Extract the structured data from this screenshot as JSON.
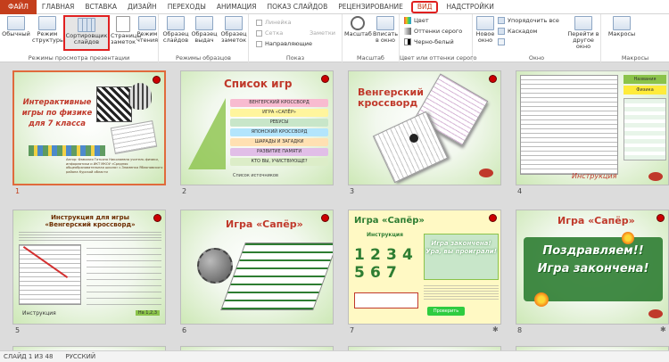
{
  "tabs": [
    "ФАЙЛ",
    "ГЛАВНАЯ",
    "ВСТАВКА",
    "ДИЗАЙН",
    "ПЕРЕХОДЫ",
    "АНИМАЦИЯ",
    "ПОКАЗ СЛАЙДОВ",
    "РЕЦЕНЗИРОВАНИЕ",
    "ВИД",
    "НАДСТРОЙКИ"
  ],
  "ribbon": {
    "views": {
      "label": "Режимы просмотра презентации",
      "normal": "Обычный",
      "outline": "Режим структуры",
      "sorter": "Сортировщик слайдов",
      "notes": "Страницы заметок",
      "reading": "Режим чтения"
    },
    "masters": {
      "label": "Режимы образцов",
      "slide_master": "Образец слайдов",
      "handout_master": "Образец выдач",
      "notes_master": "Образец заметок"
    },
    "show": {
      "label": "Показ",
      "ruler": "Линейка",
      "grid": "Сетка",
      "guides": "Направляющие",
      "notes": "Заметки"
    },
    "zoom": {
      "label": "Масштаб",
      "zoom": "Масштаб",
      "fit": "Вписать в окно"
    },
    "color": {
      "label": "Цвет или оттенки серого",
      "color": "Цвет",
      "grayscale": "Оттенки серого",
      "bw": "Черно-белый"
    },
    "window": {
      "label": "Окно",
      "new_window": "Новое окно",
      "arrange": "Упорядочить все",
      "cascade": "Каскадом",
      "move_split": "",
      "switch": "Перейти в другое окно"
    },
    "macros": {
      "label": "Макросы",
      "macros": "Макросы"
    }
  },
  "slides": [
    {
      "number": "1",
      "title": "Интерактивные игры по физике для 7 класса",
      "author": "Автор: Фамилия Татьяна Николаевна учитель физики, информатики и ИКТ МКОУ «Средняя общеобразовательная школа» с.Знаменка Яблоновского района Курской области",
      "selected": true
    },
    {
      "number": "2",
      "title": "Список игр",
      "menu": [
        "ВЕНГЕРСКИЙ КРОССВОРД",
        "ИГРА «САПЁР»",
        "РЕБУСЫ",
        "ЯПОНСКИЙ КРОССВОРД",
        "ШАРАДЫ И ЗАГАДКИ",
        "РАЗВИТИЕ ПАМЯТИ",
        "КТО ВЫ, УЧИСТВУЮЩЕ?"
      ],
      "footer": "Список источников"
    },
    {
      "number": "3",
      "title": "Венгерский кроссворд"
    },
    {
      "number": "4",
      "side_labels": [
        "Названия",
        "Физика"
      ],
      "footer": "Инструкция"
    },
    {
      "number": "5",
      "title": "Инструкция для игры «Венгерский кроссворд»",
      "footer_left": "Инструкция",
      "footer_right": "На 1,2,3"
    },
    {
      "number": "6",
      "title": "Игра «Сапёр»"
    },
    {
      "number": "7",
      "title": "Игра «Сапёр»",
      "subtitle": "Инструкция",
      "digits": [
        "1",
        "2",
        "3",
        "4",
        "5",
        "6",
        "7"
      ],
      "right_text": "Игра закончена! Ура, вы проиграли!",
      "check_button": "Проверить",
      "star": "✱"
    },
    {
      "number": "8",
      "title": "Игра «Сапёр»",
      "banner": "Поздравляем!! Игра закончена!",
      "star": "✱"
    }
  ],
  "status": {
    "slide": "СЛАЙД 1 ИЗ 48",
    "language": "РУССКИЙ"
  },
  "colors": {
    "accent": "#c43e1c",
    "highlight": "#e02020",
    "slide_green": "#cde8b6"
  }
}
